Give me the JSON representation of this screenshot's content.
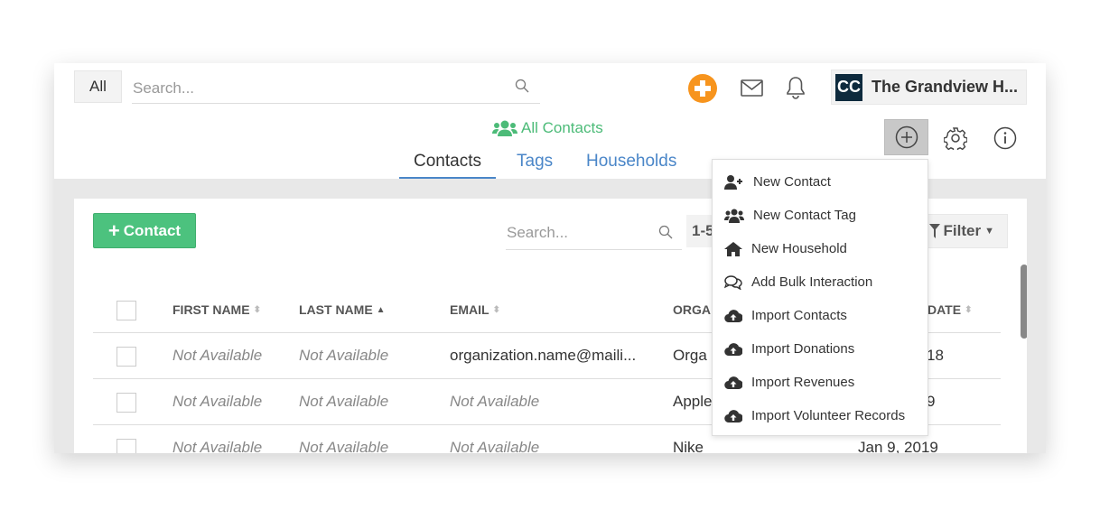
{
  "topbar": {
    "scope": "All",
    "search_placeholder": "Search...",
    "org_initials": "CC",
    "org_name": "The Grandview H..."
  },
  "header": {
    "title": "All Contacts",
    "tabs": [
      {
        "label": "Contacts",
        "active": true
      },
      {
        "label": "Tags"
      },
      {
        "label": "Households"
      }
    ]
  },
  "toolbar": {
    "add_label": "Contact",
    "search_placeholder": "Search...",
    "pager": "1-5",
    "filter_label": "Filter"
  },
  "table": {
    "columns": [
      "FIRST NAME",
      "LAST NAME",
      "EMAIL",
      "ORGA",
      "DATE"
    ],
    "rows": [
      [
        "Not Available",
        "Not Available",
        "organization.name@maili...",
        "Orga",
        "18"
      ],
      [
        "Not Available",
        "Not Available",
        "Not Available",
        "Apple",
        "9"
      ],
      [
        "Not Available",
        "Not Available",
        "Not Available",
        "Nike",
        "Jan 9, 2019"
      ]
    ]
  },
  "menu": {
    "items": [
      {
        "label": "New Contact",
        "icon": "user-plus-icon"
      },
      {
        "label": "New Contact Tag",
        "icon": "users-icon"
      },
      {
        "label": "New Household",
        "icon": "home-icon"
      },
      {
        "label": "Add Bulk Interaction",
        "icon": "comments-icon"
      },
      {
        "label": "Import Contacts",
        "icon": "cloud-upload-icon"
      },
      {
        "label": "Import Donations",
        "icon": "cloud-upload-icon"
      },
      {
        "label": "Import Revenues",
        "icon": "cloud-upload-icon"
      },
      {
        "label": "Import Volunteer Records",
        "icon": "cloud-upload-icon"
      }
    ]
  },
  "colors": {
    "accent_green": "#4cc27e",
    "tab_blue": "#4a86c8",
    "orange": "#f7941d",
    "org_badge": "#0e2a3d"
  }
}
